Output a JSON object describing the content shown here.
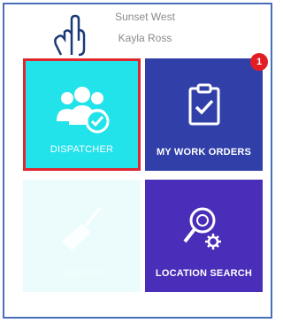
{
  "header": {
    "line1": "Sunset West",
    "line2": "Kayla Ross"
  },
  "tiles": [
    {
      "label": "DISPATCHER",
      "icon": "team-check-icon",
      "color": "#22e2ea"
    },
    {
      "label": "MY WORK ORDERS",
      "icon": "clipboard-check-icon",
      "color": "#3040a8",
      "badge": "1"
    },
    {
      "label": "JANITOR",
      "icon": "broom-icon",
      "color": "#ecfcfc"
    },
    {
      "label": "LOCATION SEARCH",
      "icon": "magnifier-gear-icon",
      "color": "#4a2db8"
    }
  ],
  "highlight_color": "#e0262e",
  "pointer": "hand-pointer-icon"
}
